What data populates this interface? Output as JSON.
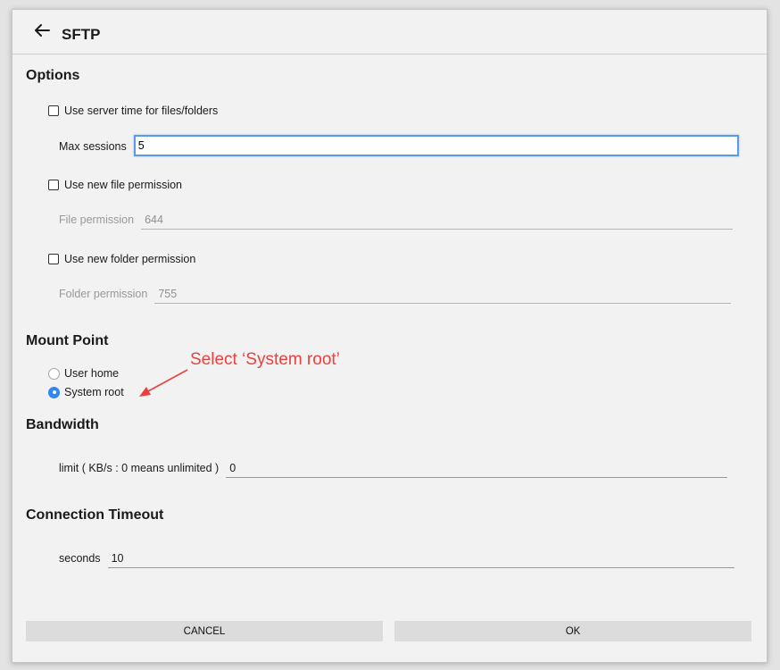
{
  "header": {
    "title": "SFTP",
    "back_icon": "arrow-left-icon"
  },
  "options": {
    "heading": "Options",
    "server_time_label": "Use server time for files/folders",
    "server_time_checked": false,
    "max_sessions_label": "Max sessions",
    "max_sessions_value": "5",
    "new_file_perm_label": "Use new file permission",
    "new_file_perm_checked": false,
    "file_perm_label": "File permission",
    "file_perm_value": "644",
    "new_folder_perm_label": "Use new folder permission",
    "new_folder_perm_checked": false,
    "folder_perm_label": "Folder permission",
    "folder_perm_value": "755"
  },
  "mount_point": {
    "heading": "Mount Point",
    "options": [
      "User home",
      "System root"
    ],
    "selected": "System root"
  },
  "annotation": {
    "text": "Select ‘System root’",
    "color": "#e8413e"
  },
  "bandwidth": {
    "heading": "Bandwidth",
    "limit_label": "limit ( KB/s : 0 means unlimited )",
    "limit_value": "0"
  },
  "timeout": {
    "heading": "Connection Timeout",
    "seconds_label": "seconds",
    "seconds_value": "10"
  },
  "buttons": {
    "cancel": "CANCEL",
    "ok": "OK"
  },
  "colors": {
    "accent": "#2f86f5",
    "focus_border": "#5b9be6",
    "button_bg": "#dcdcdc"
  }
}
